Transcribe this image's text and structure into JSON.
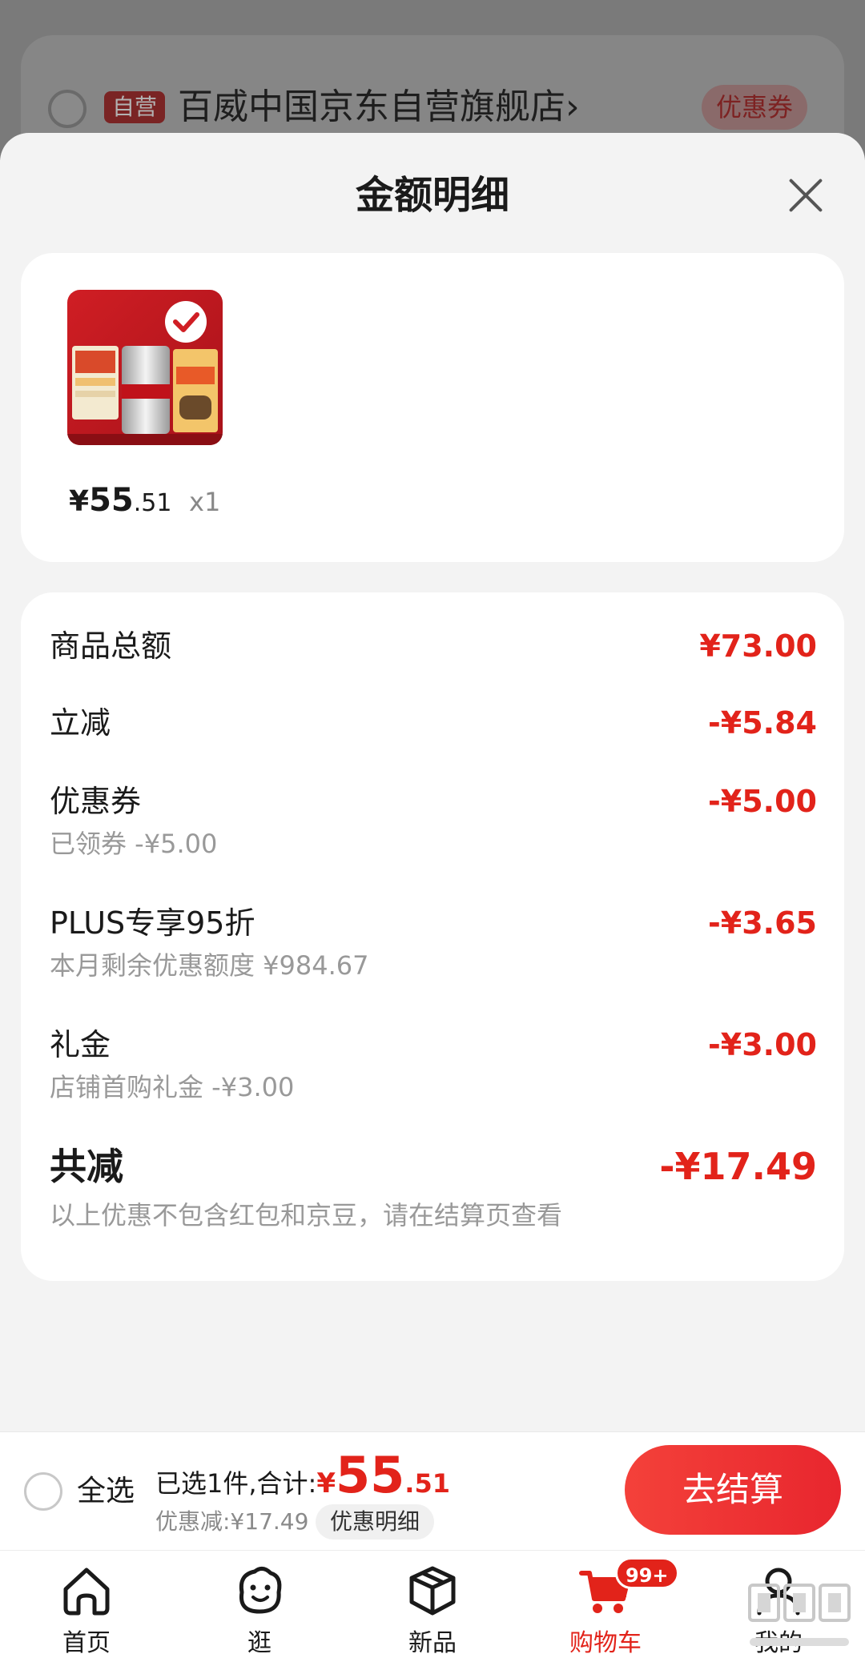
{
  "store": {
    "self_tag": "自营",
    "name": "百威中国京东自营旗舰店",
    "chevron": "›",
    "coupon_label": "优惠券"
  },
  "sheet": {
    "title": "金额明细"
  },
  "product": {
    "price_symbol": "¥",
    "price_int": "55",
    "price_dec": ".51",
    "quantity": "x1"
  },
  "details": {
    "goods_total": {
      "label": "商品总额",
      "value": "¥73.00"
    },
    "instant_discount": {
      "label": "立减",
      "value": "-¥5.84"
    },
    "coupon": {
      "label": "优惠券",
      "sub": "已领券 -¥5.00",
      "value": "-¥5.00"
    },
    "plus": {
      "label": "PLUS专享95折",
      "sub": "本月剩余优惠额度 ¥984.67",
      "value": "-¥3.65"
    },
    "gift_money": {
      "label": "礼金",
      "sub": "店铺首购礼金 -¥3.00",
      "value": "-¥3.00"
    },
    "total_saved": {
      "label": "共减",
      "sub": "以上优惠不包含红包和京豆，请在结算页查看",
      "value": "-¥17.49"
    }
  },
  "settle": {
    "select_all": "全选",
    "summary_prefix": "已选1件,合计:",
    "sum_symbol": "¥",
    "sum_int": "55",
    "sum_dec": ".51",
    "saved": "优惠减:¥17.49",
    "detail_link": "优惠明细",
    "checkout": "去结算"
  },
  "tabs": [
    {
      "label": "首页",
      "icon": "home-icon"
    },
    {
      "label": "逛",
      "icon": "face-icon"
    },
    {
      "label": "新品",
      "icon": "box-icon"
    },
    {
      "label": "购物车",
      "icon": "cart-icon",
      "badge": "99+"
    },
    {
      "label": "我的",
      "icon": "user-icon"
    }
  ],
  "colors": {
    "accent": "#e2231a",
    "sheet_bg": "#f3f3f3",
    "card_bg": "#ffffff",
    "muted_text": "#999999"
  }
}
